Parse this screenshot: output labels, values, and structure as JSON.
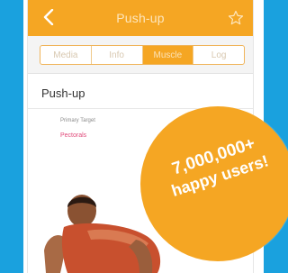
{
  "navbar": {
    "title": "Push-up",
    "back_icon": "chevron-left-icon",
    "favorite_icon": "star-outline-icon"
  },
  "tabs": [
    {
      "label": "Media",
      "active": false
    },
    {
      "label": "Info",
      "active": false
    },
    {
      "label": "Muscle",
      "active": true
    },
    {
      "label": "Log",
      "active": false
    }
  ],
  "exercise": {
    "name": "Push-up",
    "primary_target_label": "Primary Target",
    "primary_target_value": "Pectorals"
  },
  "promo": {
    "count": "7,000,000+",
    "caption": "happy users!"
  },
  "colors": {
    "accent": "#f5a623",
    "background": "#1aa1de",
    "target_text": "#e04a7a"
  }
}
